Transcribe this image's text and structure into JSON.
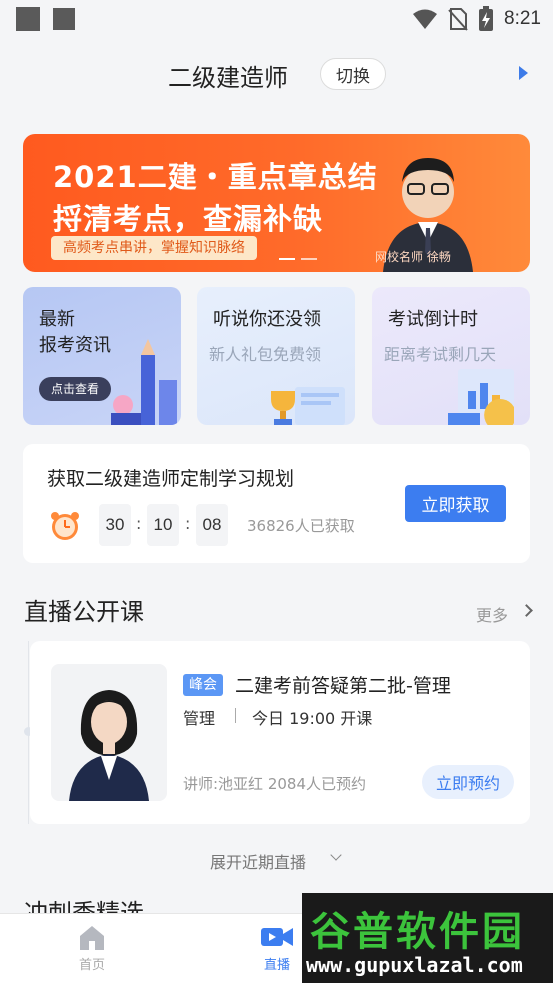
{
  "status_bar": {
    "time": "8:21"
  },
  "header": {
    "title": "二级建造师",
    "switch_label": "切换"
  },
  "banner": {
    "line1": "2021二建・重点章总结",
    "line2": "捋清考点，查漏补缺",
    "tag": "高频考点串讲，掌握知识脉络",
    "teacher_caption": "网校名师    徐畅"
  },
  "cards": [
    {
      "title": "最新\n报考资讯",
      "button": "点击查看"
    },
    {
      "title": "听说你还没领",
      "subtitle": "新人礼包免费领"
    },
    {
      "title": "考试倒计时",
      "subtitle": "距离考试剩几天"
    }
  ],
  "plan": {
    "title": "获取二级建造师定制学习规划",
    "countdown": {
      "h": "30",
      "m": "10",
      "s": "08"
    },
    "count_text": "36826人已获取",
    "button": "立即获取"
  },
  "live_section": {
    "title": "直播公开课",
    "more": "更多",
    "item": {
      "tag": "峰会",
      "title": "二建考前答疑第二批-管理",
      "subject": "管理",
      "time": "今日 19:00 开课",
      "teacher": "讲师:池亚红   2084人已预约",
      "button": "立即预约"
    },
    "expand": "展开近期直播"
  },
  "section2": {
    "title": "冲刺季精选"
  },
  "bottom_nav": [
    {
      "label": "首页",
      "active": false
    },
    {
      "label": "直播",
      "active": true
    }
  ],
  "watermark": {
    "text": "谷普软件园",
    "url": "www.gupuxlazal.com"
  },
  "colors": {
    "accent": "#3c7df0",
    "banner": "#ff5a1f",
    "watermark_green": "#3cc43c"
  }
}
